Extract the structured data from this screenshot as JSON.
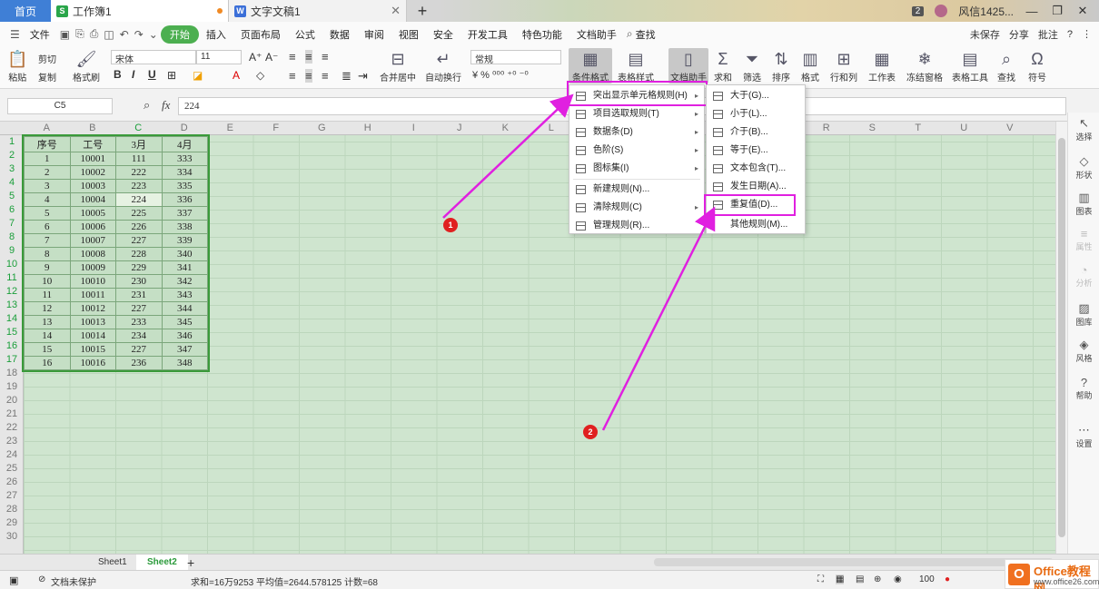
{
  "tabs": {
    "home": "首页",
    "doc1": "工作簿1",
    "doc2": "文字文稿1",
    "badge": "2",
    "user": "风信1425...",
    "min": "—",
    "restore": "❐",
    "close": "✕"
  },
  "menubar": {
    "file": "文件",
    "items": [
      "开始",
      "插入",
      "页面布局",
      "公式",
      "数据",
      "审阅",
      "视图",
      "安全",
      "开发工具",
      "特色功能",
      "文档助手"
    ],
    "search": "查找",
    "unsaved": "未保存",
    "share": "分享",
    "annotate": "批注",
    "help": "?",
    "more": "⋮"
  },
  "ribbon": {
    "cut": "剪切",
    "copy": "复制",
    "paste": "粘贴",
    "format_painter": "格式刷",
    "font_name": "宋体",
    "font_size": "11",
    "bold": "B",
    "italic": "I",
    "underline": "U",
    "merge": "合并居中",
    "wrap": "自动换行",
    "numfmt": "常规",
    "cond_format": "条件格式",
    "table_style": "表格样式",
    "doc_helper": "文档助手",
    "sum": "求和",
    "filter": "筛选",
    "sort": "排序",
    "format": "格式",
    "rowcol": "行和列",
    "sheet": "工作表",
    "freeze": "冻结窗格",
    "table_tools": "表格工具",
    "find": "查找",
    "symbol": "符号"
  },
  "formula": {
    "cell": "C5",
    "fx": "fx",
    "value": "224"
  },
  "grid": {
    "columns": [
      "A",
      "B",
      "C",
      "D",
      "E",
      "F",
      "G",
      "H",
      "I",
      "J",
      "K",
      "L",
      "M",
      "N",
      "O",
      "P",
      "Q",
      "R",
      "S",
      "T",
      "U",
      "V"
    ],
    "rows": [
      "1",
      "2",
      "3",
      "4",
      "5",
      "6",
      "7",
      "8",
      "9",
      "10",
      "11",
      "12",
      "13",
      "14",
      "15",
      "16",
      "17",
      "18",
      "19",
      "20",
      "21",
      "22",
      "23",
      "24",
      "25",
      "26",
      "27",
      "28",
      "29",
      "30"
    ],
    "table": [
      [
        "序号",
        "工号",
        "3月",
        "4月"
      ],
      [
        "1",
        "10001",
        "111",
        "333"
      ],
      [
        "2",
        "10002",
        "222",
        "334"
      ],
      [
        "3",
        "10003",
        "223",
        "335"
      ],
      [
        "4",
        "10004",
        "224",
        "336"
      ],
      [
        "5",
        "10005",
        "225",
        "337"
      ],
      [
        "6",
        "10006",
        "226",
        "338"
      ],
      [
        "7",
        "10007",
        "227",
        "339"
      ],
      [
        "8",
        "10008",
        "228",
        "340"
      ],
      [
        "9",
        "10009",
        "229",
        "341"
      ],
      [
        "10",
        "10010",
        "230",
        "342"
      ],
      [
        "11",
        "10011",
        "231",
        "343"
      ],
      [
        "12",
        "10012",
        "227",
        "344"
      ],
      [
        "13",
        "10013",
        "233",
        "345"
      ],
      [
        "14",
        "10014",
        "234",
        "346"
      ],
      [
        "15",
        "10015",
        "227",
        "347"
      ],
      [
        "16",
        "10016",
        "236",
        "348"
      ]
    ]
  },
  "menu1": {
    "items": [
      "突出显示单元格规则(H)",
      "项目选取规则(T)",
      "数据条(D)",
      "色阶(S)",
      "图标集(I)",
      "新建规则(N)...",
      "清除规则(C)",
      "管理规则(R)..."
    ]
  },
  "menu2": {
    "items": [
      "大于(G)...",
      "小于(L)...",
      "介于(B)...",
      "等于(E)...",
      "文本包含(T)...",
      "发生日期(A)...",
      "重复值(D)...",
      "其他规则(M)..."
    ]
  },
  "markers": {
    "m1": "1",
    "m2": "2"
  },
  "rpanel": [
    "选择",
    "形状",
    "图表",
    "属性",
    "分析",
    "图库",
    "风格",
    "帮助",
    "设置"
  ],
  "sheets": {
    "s1": "Sheet1",
    "s2": "Sheet2",
    "add": "+"
  },
  "status": {
    "protect": "文档未保护",
    "stats": "求和=16万9253  平均值=2644.578125  计数=68",
    "zoom": "100"
  },
  "watermark": {
    "logo": "O",
    "t1": "Office教程网",
    "t2": "www.office26.com"
  },
  "colors": {
    "accent": "#4caf50",
    "highlight": "#e020e0",
    "marker": "#e02020"
  }
}
